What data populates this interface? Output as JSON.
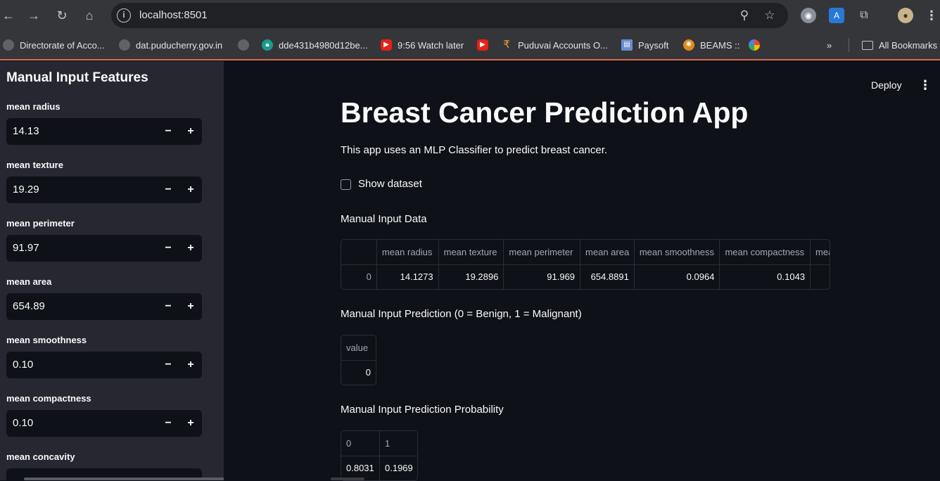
{
  "browser": {
    "url": "localhost:8501",
    "bookmarks": [
      {
        "label": "Directorate of Acco...",
        "color": "#5f6368"
      },
      {
        "label": "dat.puducherry.gov.in",
        "color": "#5f6368"
      },
      {
        "label": "",
        "color": "#5f6368"
      },
      {
        "label": "dde431b4980d12be...",
        "color": "#1a9c8c"
      },
      {
        "label": "9:56 Watch later",
        "color": "#e62117"
      },
      {
        "label": "",
        "color": "#e62117"
      },
      {
        "label": "Puduvai Accounts O...",
        "color": "#e0a030"
      },
      {
        "label": "Paysoft",
        "color": "#6a8fd1"
      },
      {
        "label": "BEAMS ::",
        "color": "#e08a1e"
      },
      {
        "label": "",
        "color": "#4285f4"
      }
    ],
    "all_bookmarks": "All Bookmarks",
    "overflow": "»"
  },
  "sidebar": {
    "title": "Manual Input Features",
    "fields": [
      {
        "label": "mean radius",
        "value": "14.13"
      },
      {
        "label": "mean texture",
        "value": "19.29"
      },
      {
        "label": "mean perimeter",
        "value": "91.97"
      },
      {
        "label": "mean area",
        "value": "654.89"
      },
      {
        "label": "mean smoothness",
        "value": "0.10"
      },
      {
        "label": "mean compactness",
        "value": "0.10"
      },
      {
        "label": "mean concavity",
        "value": ""
      }
    ],
    "minus": "−",
    "plus": "+"
  },
  "main": {
    "deploy": "Deploy",
    "menu": "⋮",
    "title": "Breast Cancer Prediction App",
    "description": "This app uses an MLP Classifier to predict breast cancer.",
    "show_dataset": "Show dataset",
    "manual_input_heading": "Manual Input Data",
    "input_table": {
      "headers": [
        "",
        "mean radius",
        "mean texture",
        "mean perimeter",
        "mean area",
        "mean smoothness",
        "mean compactness",
        "mea"
      ],
      "row": [
        "0",
        "14.1273",
        "19.2896",
        "91.969",
        "654.8891",
        "0.0964",
        "0.1043",
        ""
      ]
    },
    "prediction_heading": "Manual Input Prediction (0 = Benign, 1 = Malignant)",
    "prediction_table": {
      "headers": [
        "value"
      ],
      "row": [
        "0"
      ]
    },
    "probability_heading": "Manual Input Prediction Probability",
    "probability_table": {
      "headers": [
        "0",
        "1"
      ],
      "row": [
        "0.8031",
        "0.1969"
      ]
    }
  }
}
